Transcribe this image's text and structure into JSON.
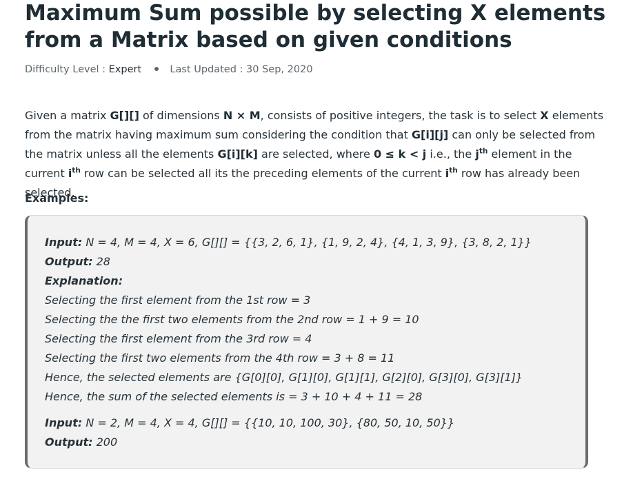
{
  "article": {
    "title": "Maximum Sum possible by selecting X elements from a Matrix based on given conditions",
    "difficulty_label": "Difficulty Level :",
    "difficulty_value": "Expert",
    "updated_label": "Last Updated :",
    "updated_value": "30 Sep, 2020"
  },
  "intro": {
    "t1": "Given a matrix ",
    "b1": "G[][]",
    "t2": " of dimensions ",
    "b2": "N × M",
    "t3": ", consists of positive integers, the task is to select ",
    "b3": "X",
    "t4": " elements from the matrix having maximum sum considering the condition that ",
    "b4": "G[i][j]",
    "t5": " can only be selected from the matrix unless all the elements ",
    "b5": "G[i][k]",
    "t6": " are selected, where ",
    "b6": "0 ≤ k < j",
    "t7": " i.e., the ",
    "b7": "j",
    "s7": "th",
    "t8": " element in the current ",
    "b8": "i",
    "s8": "th",
    "t9": " row can be selected all its the preceding elements of the current ",
    "b9": "i",
    "s9": "th",
    "t10": " row has already been selected."
  },
  "examples_label": "Examples:",
  "example": {
    "input1_label": "Input:",
    "input1_value": " N = 4, M = 4, X = 6, G[][] = {{3, 2, 6, 1}, {1, 9, 2, 4}, {4, 1, 3, 9}, {3, 8, 2, 1}}",
    "output1_label": "Output:",
    "output1_value": " 28",
    "explanation_label": "Explanation:",
    "exp_lines": [
      "Selecting the first element from the 1st row = 3",
      "Selecting the the first two elements from the 2nd row = 1 + 9 = 10",
      "Selecting the first element from the 3rd row = 4",
      "Selecting the first two elements from the 4th row = 3 + 8 = 11",
      "Hence, the selected elements are {G[0][0], G[1][0], G[1][1], G[2][0], G[3][0], G[3][1]}",
      "Hence, the sum of the selected elements is = 3 + 10 + 4 + 11 = 28"
    ],
    "input2_label": "Input:",
    "input2_value": " N = 2, M = 4, X = 4, G[][] = {{10, 10, 100, 30}, {80, 50, 10, 50}}",
    "output2_label": "Output:",
    "output2_value": " 200"
  }
}
